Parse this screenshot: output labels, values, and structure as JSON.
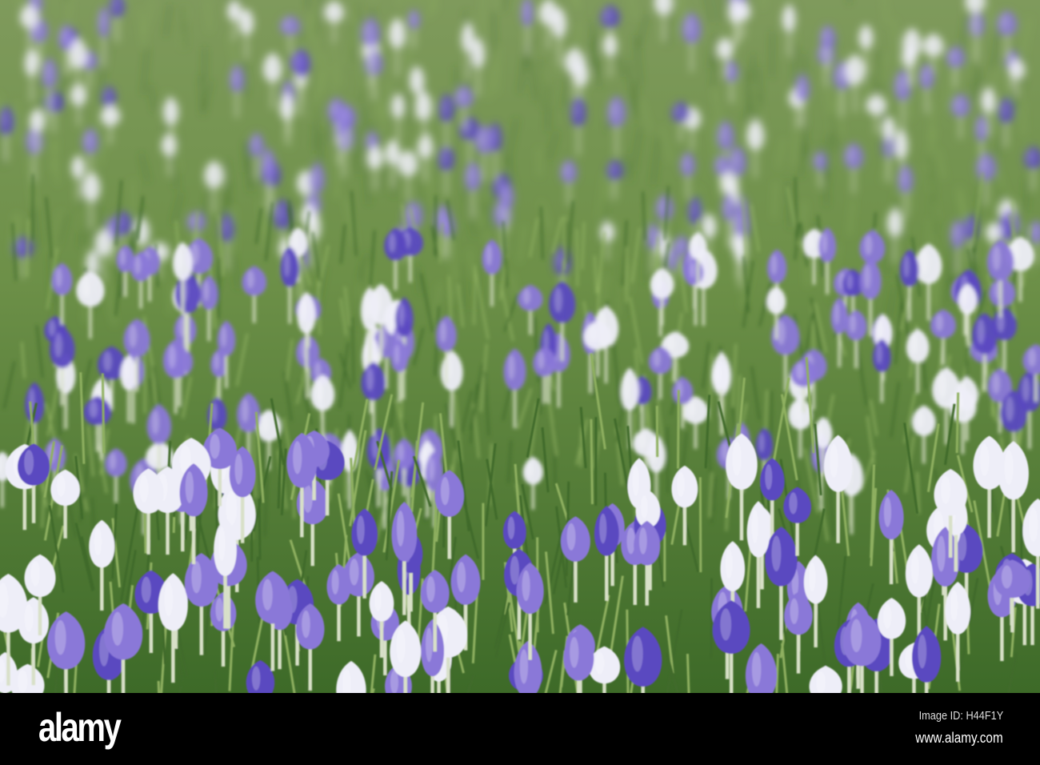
{
  "photo": {
    "subject": "crocus meadow",
    "colors": {
      "grass_dark": "#3f6a2a",
      "grass_light": "#8fb060",
      "purple": "#8a78d8",
      "deep_purple": "#5a48c0",
      "white": "#eeeef8"
    }
  },
  "watermark": {
    "logo": "alamy",
    "image_id": "Image ID: H44F1Y",
    "url": "www.alamy.com"
  }
}
